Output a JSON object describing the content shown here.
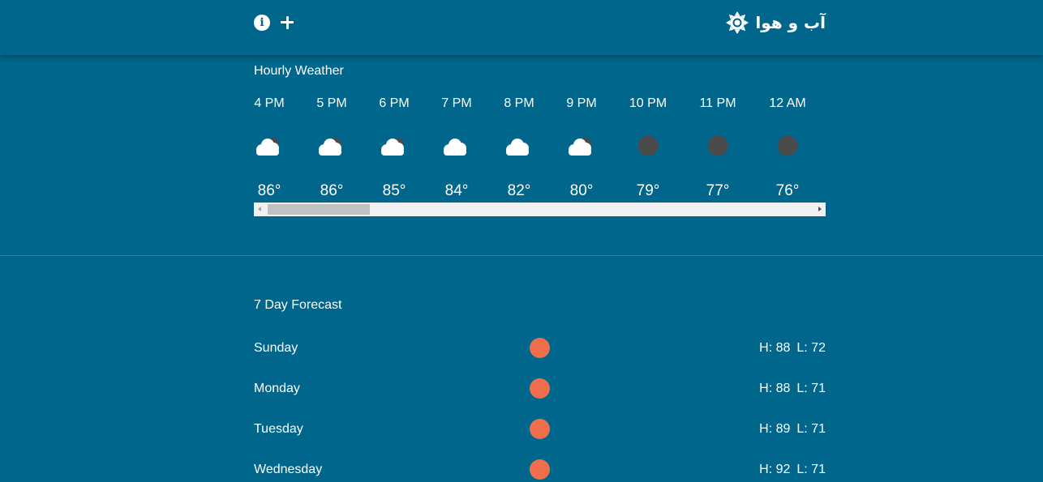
{
  "header": {
    "app_title": "آب و هوا",
    "icons": [
      "info-icon",
      "add-icon",
      "sun-icon"
    ]
  },
  "hourly": {
    "title": "Hourly Weather",
    "items": [
      {
        "time": "4 PM",
        "icon": "partly-cloudy-night-icon",
        "temp": "86°"
      },
      {
        "time": "5 PM",
        "icon": "partly-cloudy-night-icon",
        "temp": "86°"
      },
      {
        "time": "6 PM",
        "icon": "partly-cloudy-night-icon",
        "temp": "85°"
      },
      {
        "time": "7 PM",
        "icon": "cloud-icon",
        "temp": "84°"
      },
      {
        "time": "8 PM",
        "icon": "cloud-icon",
        "temp": "82°"
      },
      {
        "time": "9 PM",
        "icon": "partly-cloudy-night-icon",
        "temp": "80°"
      },
      {
        "time": "10 PM",
        "icon": "clear-night-icon",
        "temp": "79°"
      },
      {
        "time": "11 PM",
        "icon": "clear-night-icon",
        "temp": "77°"
      },
      {
        "time": "12 AM",
        "icon": "clear-night-icon",
        "temp": "76°"
      }
    ]
  },
  "forecast": {
    "title": "7 Day Forecast",
    "days": [
      {
        "name": "Sunday",
        "icon": "sun-icon",
        "high": "H: 88",
        "low": "L: 72"
      },
      {
        "name": "Monday",
        "icon": "sun-icon",
        "high": "H: 88",
        "low": "L: 71"
      },
      {
        "name": "Tuesday",
        "icon": "sun-icon",
        "high": "H: 89",
        "low": "L: 71"
      },
      {
        "name": "Wednesday",
        "icon": "sun-icon",
        "high": "H: 92",
        "low": "L: 71"
      }
    ]
  },
  "colors": {
    "background": "#00668c",
    "sun": "#ef6f4d",
    "moon": "#4a4a4a",
    "cloud": "#ffffff"
  }
}
